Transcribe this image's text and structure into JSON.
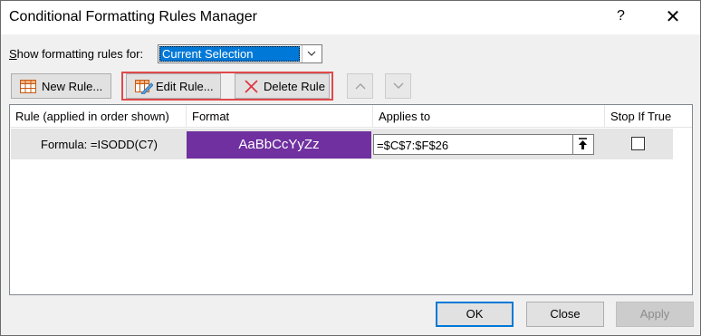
{
  "dialog": {
    "title": "Conditional Formatting Rules Manager",
    "help_label": "?",
    "close_label": "✕"
  },
  "show_rules": {
    "label_prefix": "S",
    "label_rest": "how formatting rules for:",
    "selected": "Current Selection"
  },
  "toolbar": {
    "new_rule": "New Rule...",
    "new_rule_underline": "N",
    "edit_rule": "Edit Rule...",
    "delete_rule": "Delete Rule"
  },
  "table": {
    "columns": [
      "Rule (applied in order shown)",
      "Format",
      "Applies to",
      "Stop If True"
    ],
    "rows": [
      {
        "rule": "Formula: =ISODD(C7)",
        "format_preview": "AaBbCcYyZz",
        "applies_to": "=$C$7:$F$26",
        "stop_if_true": false
      }
    ]
  },
  "buttons": {
    "ok": "OK",
    "close": "Close",
    "apply": "Apply"
  },
  "colors": {
    "format_fill": "#7030a0",
    "highlight_border": "#e0494c",
    "selection": "#0078d7"
  }
}
